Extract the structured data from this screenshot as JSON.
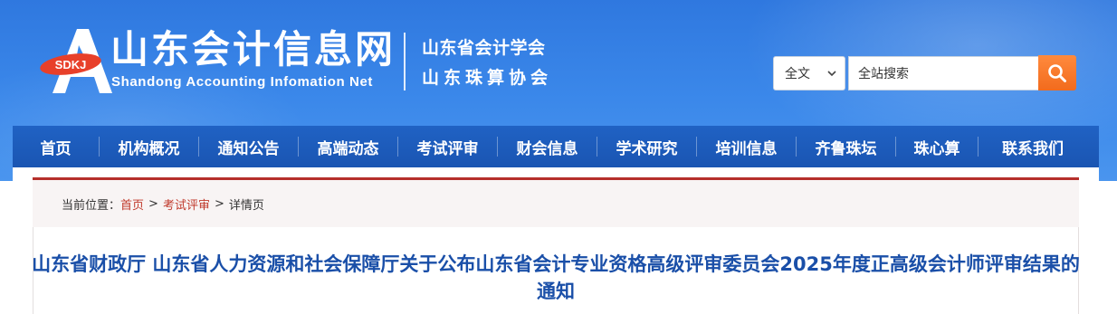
{
  "site": {
    "name_cn": "山东会计信息网",
    "name_en": "Shandong Accounting Infomation Net",
    "logo_badge": "SDKJ",
    "org_1": "山东省会计学会",
    "org_2": "山东珠算协会"
  },
  "search": {
    "scope_selected": "全文",
    "placeholder": "全站搜索",
    "button_icon": "search-icon"
  },
  "nav": {
    "items": [
      {
        "label": "首页"
      },
      {
        "label": "机构概况"
      },
      {
        "label": "通知公告"
      },
      {
        "label": "高端动态"
      },
      {
        "label": "考试评审"
      },
      {
        "label": "财会信息"
      },
      {
        "label": "学术研究"
      },
      {
        "label": "培训信息"
      },
      {
        "label": "齐鲁珠坛"
      },
      {
        "label": "珠心算"
      },
      {
        "label": "联系我们"
      }
    ]
  },
  "breadcrumb": {
    "prefix": "当前位置：",
    "home": "首页",
    "section": "考试评审",
    "current": "详情页",
    "separator": ">"
  },
  "article": {
    "title": "山东省财政厅 山东省人力资源和社会保障厅关于公布山东省会计专业资格高级评审委员会2025年度正高级会计师评审结果的通知"
  },
  "colors": {
    "header_blue": "#3b88ea",
    "nav_blue": "#1a55b2",
    "accent_orange": "#f26b1d",
    "breadcrumb_red": "#b52f2b",
    "title_blue": "#1a4fa8"
  }
}
